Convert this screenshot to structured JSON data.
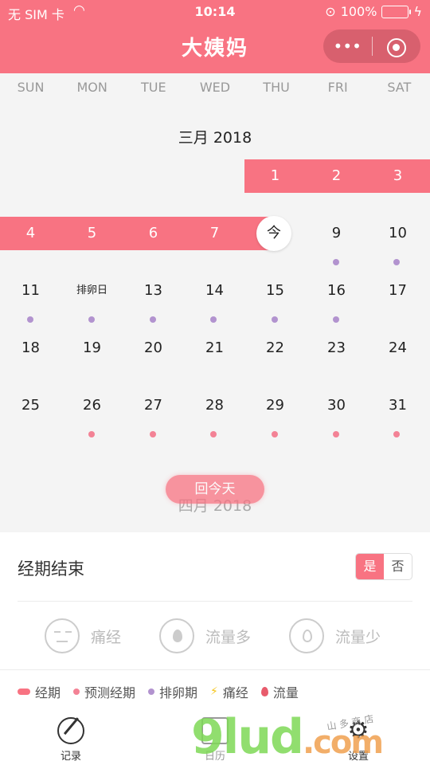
{
  "status": {
    "carrier": "无 SIM 卡",
    "time": "10:14",
    "battery": "100%"
  },
  "header": {
    "title": "大姨妈",
    "menu_icon": "more-dots-icon",
    "close_icon": "target-circle-icon"
  },
  "weekdays": [
    "SUN",
    "MON",
    "TUE",
    "WED",
    "THU",
    "FRI",
    "SAT"
  ],
  "calendar": {
    "month_label": "三月 2018",
    "today_label": "今",
    "ovulation_label": "排卵日",
    "next_month_label": "四月 2018",
    "back_today": "回今天",
    "weeks": [
      [
        "",
        "",
        "",
        "",
        "1",
        "2",
        "3"
      ],
      [
        "4",
        "5",
        "6",
        "7",
        "今",
        "9",
        "10"
      ],
      [
        "11",
        "排卵日",
        "13",
        "14",
        "15",
        "16",
        "17"
      ],
      [
        "18",
        "19",
        "20",
        "21",
        "22",
        "23",
        "24"
      ],
      [
        "25",
        "26",
        "27",
        "28",
        "29",
        "30",
        "31"
      ]
    ],
    "colors": {
      "period": "#f87382",
      "ovulation_dot": "#b293cf",
      "predicted_dot": "#f38295"
    }
  },
  "panel": {
    "period_end_label": "经期结束",
    "toggle_yes": "是",
    "toggle_no": "否",
    "symptoms": [
      "痛经",
      "流量多",
      "流量少"
    ],
    "legend": [
      "经期",
      "预测经期",
      "排卵期",
      "痛经",
      "流量"
    ]
  },
  "tabs": {
    "record": "记录",
    "calendar": "日历",
    "settings": "设置"
  },
  "watermark": {
    "main": "9lud",
    "suffix": ".com",
    "shop": "山 多 商 店"
  }
}
